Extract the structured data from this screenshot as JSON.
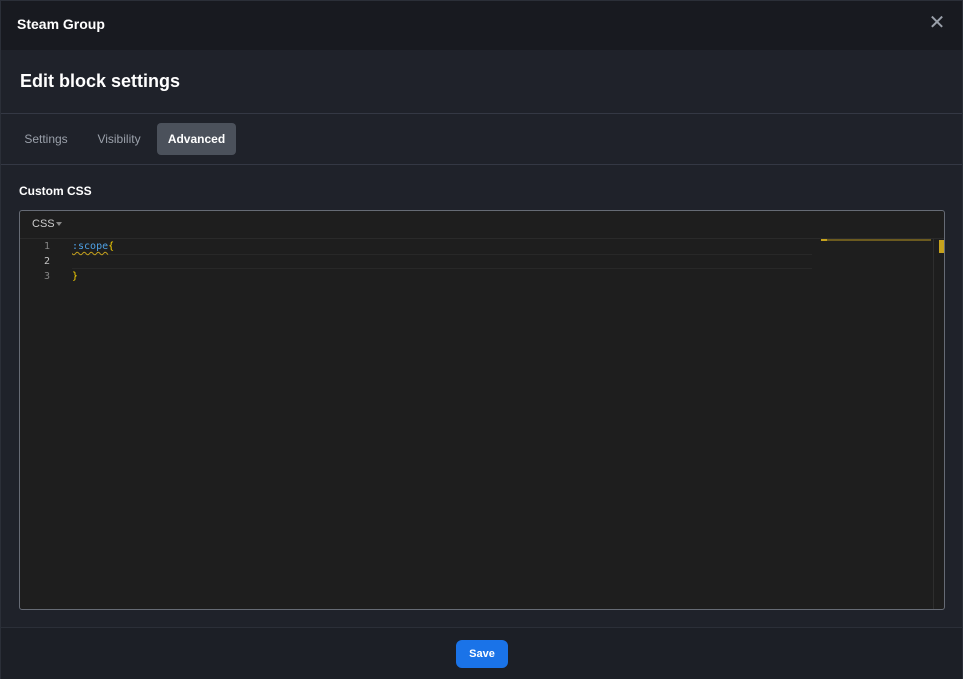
{
  "window": {
    "title": "Steam Group",
    "close_icon": "close-icon"
  },
  "header": {
    "title": "Edit block settings"
  },
  "tabs": [
    {
      "label": "Settings",
      "active": false
    },
    {
      "label": "Visibility",
      "active": false
    },
    {
      "label": "Advanced",
      "active": true
    }
  ],
  "custom_css": {
    "label": "Custom CSS",
    "language": "CSS",
    "lines": [
      {
        "number": "1",
        "text_selector": ":scope",
        "text_brace": "{"
      },
      {
        "number": "2",
        "text_selector": "",
        "text_brace": ""
      },
      {
        "number": "3",
        "text_selector": "",
        "text_brace": "}"
      }
    ],
    "active_line": 2
  },
  "footer": {
    "save_label": "Save"
  },
  "colors": {
    "accent": "#1a73e8",
    "active_tab": "#4b515b",
    "editor_bg": "#1e1e1e",
    "warning_marker": "#c6a21d"
  }
}
